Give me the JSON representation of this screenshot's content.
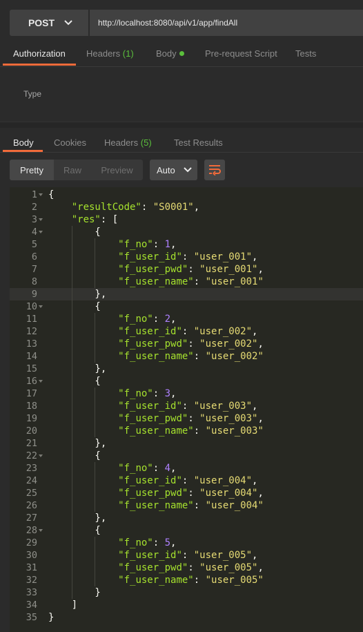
{
  "request": {
    "method": "POST",
    "url": "http://localhost:8080/api/v1/app/findAll"
  },
  "request_tabs": [
    {
      "label": "Authorization",
      "count": ""
    },
    {
      "label": "Headers",
      "count": "(1)"
    },
    {
      "label": "Body",
      "count": ""
    },
    {
      "label": "Pre-request Script",
      "count": ""
    },
    {
      "label": "Tests",
      "count": ""
    }
  ],
  "auth": {
    "type_label": "Type"
  },
  "response_tabs": [
    {
      "label": "Body",
      "count": ""
    },
    {
      "label": "Cookies",
      "count": ""
    },
    {
      "label": "Headers",
      "count": "(5)"
    },
    {
      "label": "Test Results",
      "count": ""
    }
  ],
  "view_modes": [
    "Pretty",
    "Raw",
    "Preview"
  ],
  "format": "Auto",
  "colors": {
    "accent": "#f26b3a",
    "badge_green": "#5bbf3c",
    "json_key": "#a6e22e",
    "json_string": "#e6db74",
    "json_number": "#ae81ff"
  },
  "icons": {
    "method_dropdown": "chevron-down-icon",
    "format_dropdown": "chevron-down-icon",
    "wrap": "wrap-lines-icon",
    "body_indicator": "status-dot-icon"
  },
  "code_lines": [
    [
      [
        "p",
        "{"
      ]
    ],
    [
      [
        "p",
        "    "
      ],
      [
        "k",
        "\"resultCode\""
      ],
      [
        "p",
        ": "
      ],
      [
        "s",
        "\"S0001\""
      ],
      [
        "p",
        ","
      ]
    ],
    [
      [
        "p",
        "    "
      ],
      [
        "k",
        "\"res\""
      ],
      [
        "p",
        ": ["
      ]
    ],
    [
      [
        "p",
        "        {"
      ]
    ],
    [
      [
        "p",
        "            "
      ],
      [
        "k",
        "\"f_no\""
      ],
      [
        "p",
        ": "
      ],
      [
        "n",
        "1"
      ],
      [
        "p",
        ","
      ]
    ],
    [
      [
        "p",
        "            "
      ],
      [
        "k",
        "\"f_user_id\""
      ],
      [
        "p",
        ": "
      ],
      [
        "s",
        "\"user_001\""
      ],
      [
        "p",
        ","
      ]
    ],
    [
      [
        "p",
        "            "
      ],
      [
        "k",
        "\"f_user_pwd\""
      ],
      [
        "p",
        ": "
      ],
      [
        "s",
        "\"user_001\""
      ],
      [
        "p",
        ","
      ]
    ],
    [
      [
        "p",
        "            "
      ],
      [
        "k",
        "\"f_user_name\""
      ],
      [
        "p",
        ": "
      ],
      [
        "s",
        "\"user_001\""
      ]
    ],
    [
      [
        "p",
        "        },"
      ]
    ],
    [
      [
        "p",
        "        {"
      ]
    ],
    [
      [
        "p",
        "            "
      ],
      [
        "k",
        "\"f_no\""
      ],
      [
        "p",
        ": "
      ],
      [
        "n",
        "2"
      ],
      [
        "p",
        ","
      ]
    ],
    [
      [
        "p",
        "            "
      ],
      [
        "k",
        "\"f_user_id\""
      ],
      [
        "p",
        ": "
      ],
      [
        "s",
        "\"user_002\""
      ],
      [
        "p",
        ","
      ]
    ],
    [
      [
        "p",
        "            "
      ],
      [
        "k",
        "\"f_user_pwd\""
      ],
      [
        "p",
        ": "
      ],
      [
        "s",
        "\"user_002\""
      ],
      [
        "p",
        ","
      ]
    ],
    [
      [
        "p",
        "            "
      ],
      [
        "k",
        "\"f_user_name\""
      ],
      [
        "p",
        ": "
      ],
      [
        "s",
        "\"user_002\""
      ]
    ],
    [
      [
        "p",
        "        },"
      ]
    ],
    [
      [
        "p",
        "        {"
      ]
    ],
    [
      [
        "p",
        "            "
      ],
      [
        "k",
        "\"f_no\""
      ],
      [
        "p",
        ": "
      ],
      [
        "n",
        "3"
      ],
      [
        "p",
        ","
      ]
    ],
    [
      [
        "p",
        "            "
      ],
      [
        "k",
        "\"f_user_id\""
      ],
      [
        "p",
        ": "
      ],
      [
        "s",
        "\"user_003\""
      ],
      [
        "p",
        ","
      ]
    ],
    [
      [
        "p",
        "            "
      ],
      [
        "k",
        "\"f_user_pwd\""
      ],
      [
        "p",
        ": "
      ],
      [
        "s",
        "\"user_003\""
      ],
      [
        "p",
        ","
      ]
    ],
    [
      [
        "p",
        "            "
      ],
      [
        "k",
        "\"f_user_name\""
      ],
      [
        "p",
        ": "
      ],
      [
        "s",
        "\"user_003\""
      ]
    ],
    [
      [
        "p",
        "        },"
      ]
    ],
    [
      [
        "p",
        "        {"
      ]
    ],
    [
      [
        "p",
        "            "
      ],
      [
        "k",
        "\"f_no\""
      ],
      [
        "p",
        ": "
      ],
      [
        "n",
        "4"
      ],
      [
        "p",
        ","
      ]
    ],
    [
      [
        "p",
        "            "
      ],
      [
        "k",
        "\"f_user_id\""
      ],
      [
        "p",
        ": "
      ],
      [
        "s",
        "\"user_004\""
      ],
      [
        "p",
        ","
      ]
    ],
    [
      [
        "p",
        "            "
      ],
      [
        "k",
        "\"f_user_pwd\""
      ],
      [
        "p",
        ": "
      ],
      [
        "s",
        "\"user_004\""
      ],
      [
        "p",
        ","
      ]
    ],
    [
      [
        "p",
        "            "
      ],
      [
        "k",
        "\"f_user_name\""
      ],
      [
        "p",
        ": "
      ],
      [
        "s",
        "\"user_004\""
      ]
    ],
    [
      [
        "p",
        "        },"
      ]
    ],
    [
      [
        "p",
        "        {"
      ]
    ],
    [
      [
        "p",
        "            "
      ],
      [
        "k",
        "\"f_no\""
      ],
      [
        "p",
        ": "
      ],
      [
        "n",
        "5"
      ],
      [
        "p",
        ","
      ]
    ],
    [
      [
        "p",
        "            "
      ],
      [
        "k",
        "\"f_user_id\""
      ],
      [
        "p",
        ": "
      ],
      [
        "s",
        "\"user_005\""
      ],
      [
        "p",
        ","
      ]
    ],
    [
      [
        "p",
        "            "
      ],
      [
        "k",
        "\"f_user_pwd\""
      ],
      [
        "p",
        ": "
      ],
      [
        "s",
        "\"user_005\""
      ],
      [
        "p",
        ","
      ]
    ],
    [
      [
        "p",
        "            "
      ],
      [
        "k",
        "\"f_user_name\""
      ],
      [
        "p",
        ": "
      ],
      [
        "s",
        "\"user_005\""
      ]
    ],
    [
      [
        "p",
        "        }"
      ]
    ],
    [
      [
        "p",
        "    ]"
      ]
    ],
    [
      [
        "p",
        "}"
      ]
    ]
  ],
  "line_numbers": [
    "1",
    "2",
    "3",
    "4",
    "5",
    "6",
    "7",
    "8",
    "9",
    "10",
    "11",
    "12",
    "13",
    "14",
    "15",
    "16",
    "17",
    "18",
    "19",
    "20",
    "21",
    "22",
    "23",
    "24",
    "25",
    "26",
    "27",
    "28",
    "29",
    "30",
    "31",
    "32",
    "33",
    "34",
    "35"
  ],
  "foldable_lines": [
    1,
    3,
    4,
    10,
    16,
    22,
    28
  ],
  "highlighted_line": 9
}
